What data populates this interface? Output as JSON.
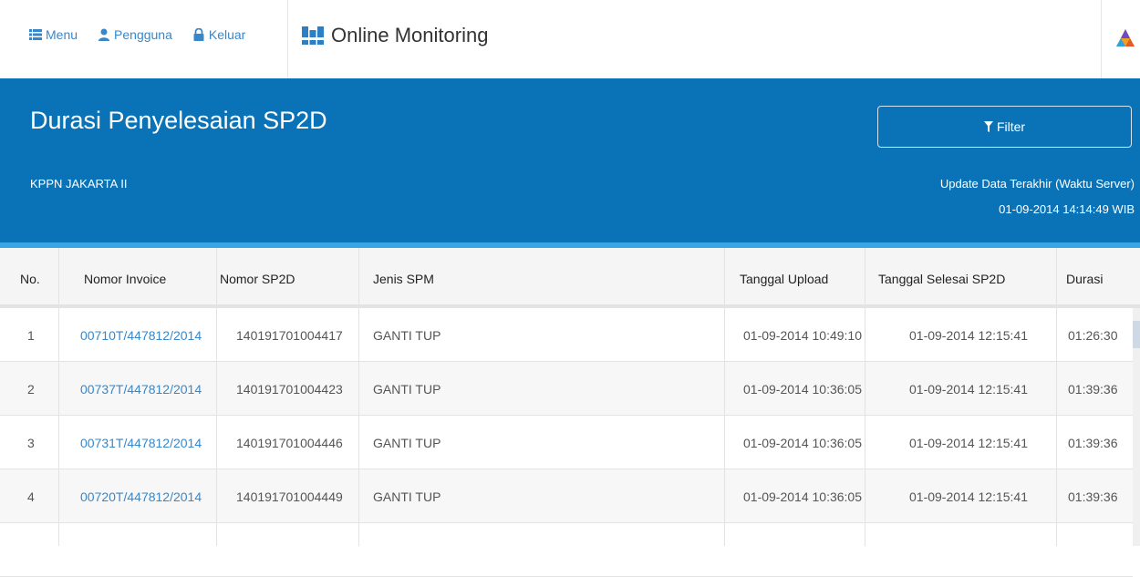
{
  "nav": {
    "menu_label": "Menu",
    "user_label": "Pengguna",
    "logout_label": "Keluar",
    "brand_title": "Online Monitoring"
  },
  "header": {
    "title": "Durasi Penyelesaian SP2D",
    "office": "KPPN JAKARTA II",
    "filter_label": "Filter",
    "update_label": "Update Data Terakhir (Waktu Server)",
    "update_time": "01-09-2014 14:14:49 WIB"
  },
  "table": {
    "columns": [
      "No.",
      "Nomor Invoice",
      "Nomor SP2D",
      "Jenis SPM",
      "Tanggal Upload",
      "Tanggal Selesai SP2D",
      "Durasi"
    ],
    "rows": [
      {
        "no": "1",
        "invoice": "00710T/447812/2014",
        "sp2d": "140191701004417",
        "jenis": "GANTI TUP",
        "upload": "01-09-2014 10:49:10",
        "selesai": "01-09-2014 12:15:41",
        "durasi": "01:26:30"
      },
      {
        "no": "2",
        "invoice": "00737T/447812/2014",
        "sp2d": "140191701004423",
        "jenis": "GANTI TUP",
        "upload": "01-09-2014 10:36:05",
        "selesai": "01-09-2014 12:15:41",
        "durasi": "01:39:36"
      },
      {
        "no": "3",
        "invoice": "00731T/447812/2014",
        "sp2d": "140191701004446",
        "jenis": "GANTI TUP",
        "upload": "01-09-2014 10:36:05",
        "selesai": "01-09-2014 12:15:41",
        "durasi": "01:39:36"
      },
      {
        "no": "4",
        "invoice": "00720T/447812/2014",
        "sp2d": "140191701004449",
        "jenis": "GANTI TUP",
        "upload": "01-09-2014 10:36:05",
        "selesai": "01-09-2014 12:15:41",
        "durasi": "01:39:36"
      }
    ]
  },
  "colors": {
    "header_blue": "#0a73b7",
    "link_blue": "#3a87c8"
  }
}
